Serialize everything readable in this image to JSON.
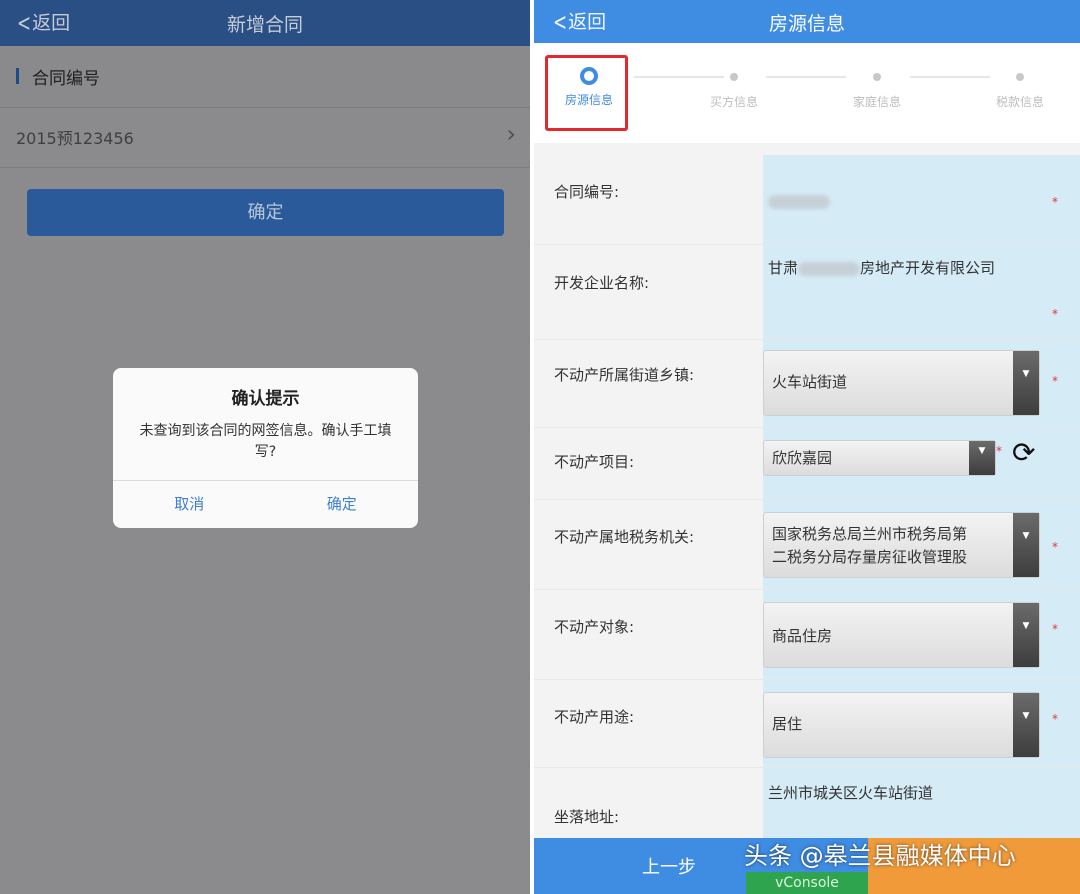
{
  "left": {
    "back_label": "返回",
    "title": "新增合同",
    "field_label": "合同编号",
    "field_value": "2015预123456",
    "confirm_button": "确定",
    "dialog": {
      "title": "确认提示",
      "message": "未查询到该合同的网签信息。确认手工填写?",
      "cancel": "取消",
      "ok": "确定"
    }
  },
  "right": {
    "back_label": "返回",
    "title": "房源信息",
    "steps": [
      {
        "label": "房源信息",
        "active": true
      },
      {
        "label": "买方信息",
        "active": false
      },
      {
        "label": "家庭信息",
        "active": false
      },
      {
        "label": "税款信息",
        "active": false
      }
    ],
    "form": {
      "contract_no_label": "合同编号:",
      "developer_label": "开发企业名称:",
      "developer_prefix": "甘肃",
      "developer_suffix": "房地产开发有限公司",
      "street_label": "不动产所属街道乡镇:",
      "street_value": "火车站街道",
      "project_label": "不动产项目:",
      "project_value": "欣欣嘉园",
      "tax_office_label": "不动产属地税务机关:",
      "tax_office_line1": "国家税务总局兰州市税务局第",
      "tax_office_line2": "二税务分局存量房征收管理股",
      "object_label": "不动产对象:",
      "object_value": "商品住房",
      "usage_label": "不动产用途:",
      "usage_value": "居住",
      "address_label": "坐落地址:",
      "address_value": "兰州市城关区火车站街道",
      "required_mark": "*"
    },
    "prev_button": "上一步",
    "vconsole": "vConsole"
  },
  "watermark": "头条 @皋兰县融媒体中心",
  "colors": {
    "header_blue": "#3f8ce3",
    "dim_header": "#2a4f84",
    "highlight_red": "#e4282c",
    "value_bg": "#d5ecf7",
    "orange": "#f09a3a"
  }
}
